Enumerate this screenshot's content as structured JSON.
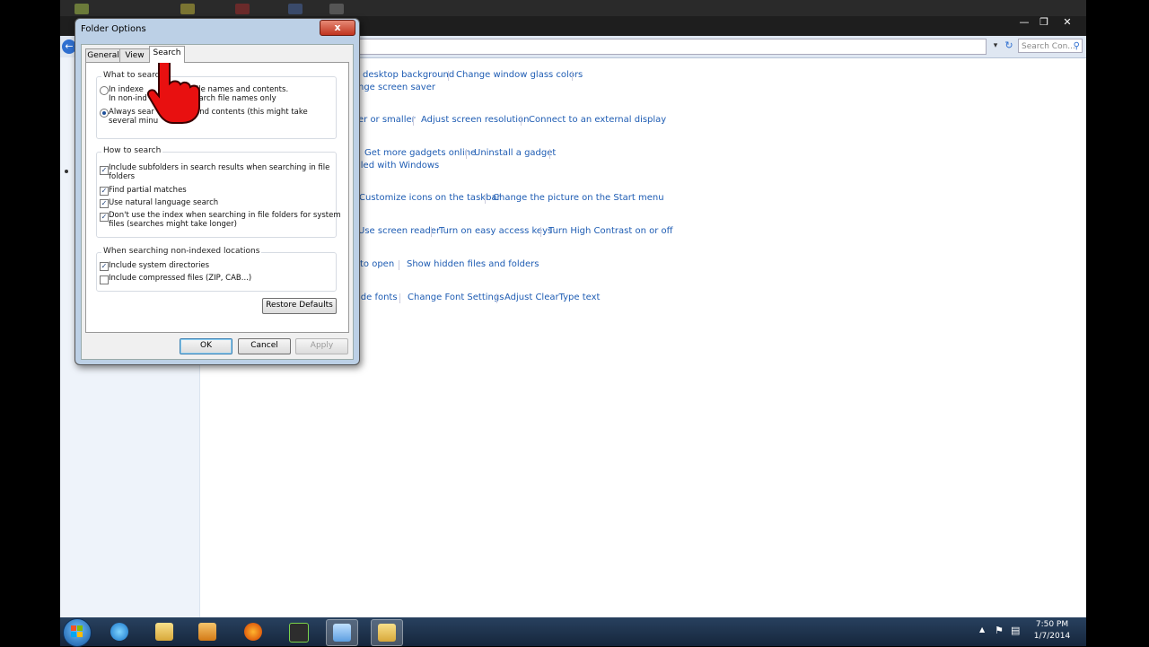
{
  "colors": {
    "link": "#1e5cb3",
    "taskbar": "#1d3150",
    "sidebar": "#eef3fa"
  },
  "control_panel": {
    "search_placeholder": "Search Con...",
    "links": [
      {
        "text": "desktop background"
      },
      {
        "text": "Change window glass colors"
      },
      {
        "text": "nge screen saver"
      },
      {
        "text": "er or smaller"
      },
      {
        "text": "Adjust screen resolution"
      },
      {
        "text": "Connect to an external display"
      },
      {
        "text": "Get more gadgets online"
      },
      {
        "text": "Uninstall a gadget"
      },
      {
        "text": "lled with Windows"
      },
      {
        "text": "Customize icons on the taskbar"
      },
      {
        "text": "Change the picture on the Start menu"
      },
      {
        "text": "Use screen reader"
      },
      {
        "text": "Turn on easy access keys"
      },
      {
        "text": "Turn High Contrast on or off"
      },
      {
        "text": "to open"
      },
      {
        "text": "Show hidden files and folders"
      },
      {
        "text": "ide fonts"
      },
      {
        "text": "Change Font Settings"
      },
      {
        "text": "Adjust ClearType text"
      }
    ]
  },
  "dialog": {
    "title": "Folder Options",
    "close_label": "x",
    "tabs": [
      {
        "label": "General",
        "active": false
      },
      {
        "label": "View",
        "active": false
      },
      {
        "label": "Search",
        "active": true
      }
    ],
    "what_to_search": {
      "label": "What to search",
      "options": [
        {
          "line1": "In indexe",
          "line1b": "rch file names and contents.",
          "line2": "In non-ind",
          "line2b": "search file names only",
          "selected": false
        },
        {
          "line1": "Always sear",
          "line1b": "s and contents (this might take",
          "line2": "several minu",
          "line2b": "",
          "selected": true
        }
      ]
    },
    "how_to_search": {
      "label": "How to search",
      "options": [
        {
          "text": "Include subfolders in search results when searching in file",
          "text2": "folders",
          "checked": true
        },
        {
          "text": "Find partial matches",
          "text2": "",
          "checked": true
        },
        {
          "text": "Use natural language search",
          "text2": "",
          "checked": true
        },
        {
          "text": "Don't use the index when searching in file folders for system",
          "text2": "files (searches might take longer)",
          "checked": true
        }
      ]
    },
    "non_indexed": {
      "label": "When searching non-indexed locations",
      "options": [
        {
          "text": "Include system directories",
          "checked": true
        },
        {
          "text": "Include compressed files (ZIP, CAB...)",
          "checked": false
        }
      ]
    },
    "restore_defaults": "Restore Defaults",
    "ok": "OK",
    "cancel": "Cancel",
    "apply": "Apply"
  },
  "taskbar": {
    "items": [
      "start-orb",
      "internet-explorer-icon",
      "windows-explorer-icon",
      "media-player-icon",
      "firefox-icon",
      "ummy-video-icon",
      "control-panel-icon",
      "folder-options-icon"
    ],
    "time": "7:50 PM",
    "date": "1/7/2014"
  }
}
